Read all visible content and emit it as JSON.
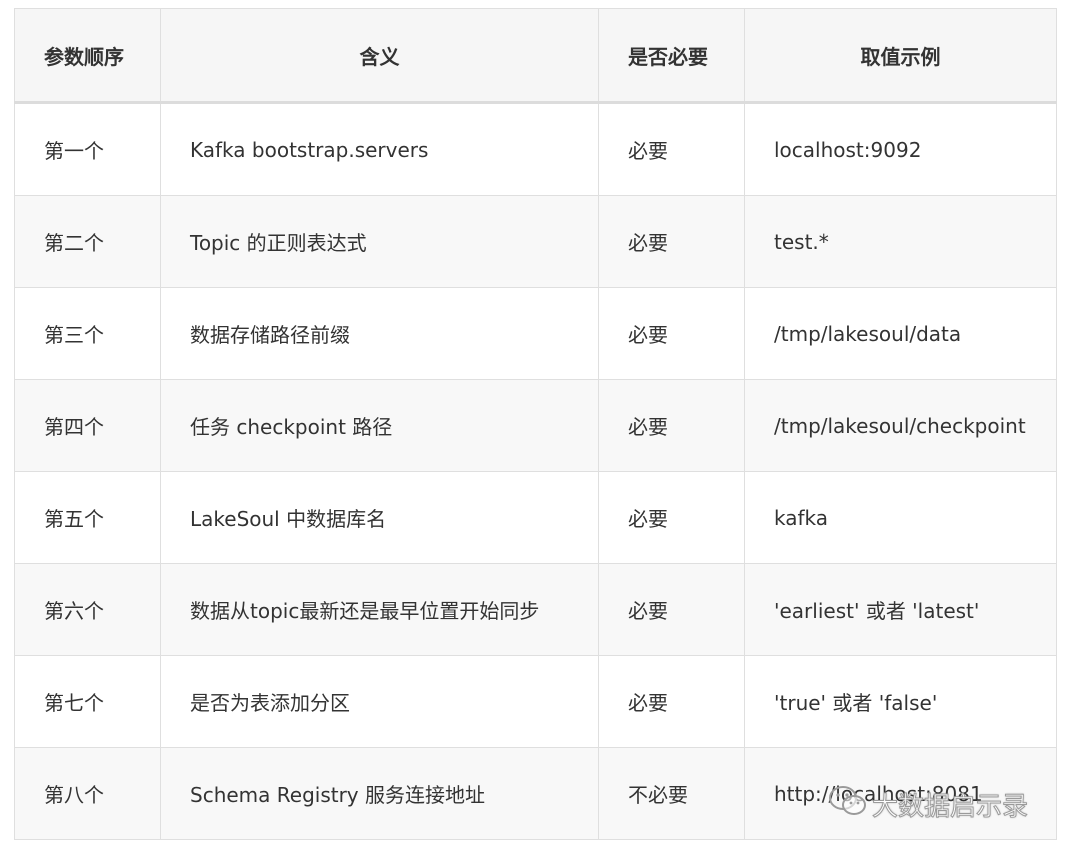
{
  "table": {
    "headers": [
      "参数顺序",
      "含义",
      "是否必要",
      "取值示例"
    ],
    "rows": [
      [
        "第一个",
        "Kafka bootstrap.servers",
        "必要",
        "localhost:9092"
      ],
      [
        "第二个",
        "Topic 的正则表达式",
        "必要",
        "test.*"
      ],
      [
        "第三个",
        "数据存储路径前缀",
        "必要",
        "/tmp/lakesoul/data"
      ],
      [
        "第四个",
        "任务 checkpoint 路径",
        "必要",
        "/tmp/lakesoul/checkpoint"
      ],
      [
        "第五个",
        "LakeSoul 中数据库名",
        "必要",
        "kafka"
      ],
      [
        "第六个",
        "数据从topic最新还是最早位置开始同步",
        "必要",
        "'earliest' 或者 'latest'"
      ],
      [
        "第七个",
        "是否为表添加分区",
        "必要",
        "'true' 或者 'false'"
      ],
      [
        "第八个",
        "Schema Registry 服务连接地址",
        "不必要",
        "http://localhost:8081"
      ]
    ]
  },
  "watermark": {
    "text": "大数据启示录",
    "icon": "wechat-icon"
  }
}
